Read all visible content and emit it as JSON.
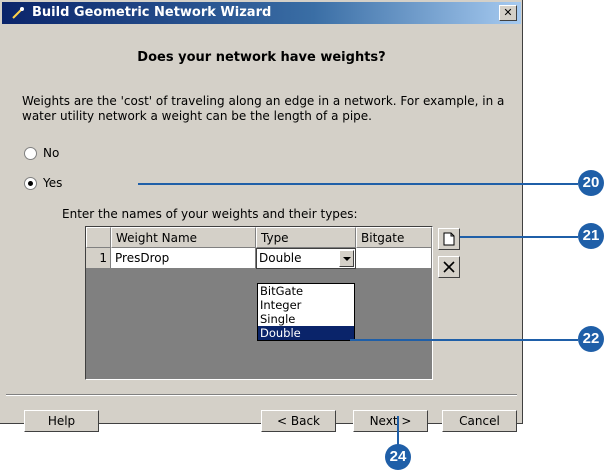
{
  "window": {
    "title": "Build Geometric Network Wizard",
    "close_label": "✕"
  },
  "heading": "Does your network have weights?",
  "description": "Weights are the 'cost' of traveling along an edge in a network. For example, in a water utility network a weight can be the length of a pipe.",
  "radios": [
    {
      "label": "No",
      "checked": false
    },
    {
      "label": "Yes",
      "checked": true
    }
  ],
  "table_label": "Enter the names of your weights and their types:",
  "table": {
    "columns": [
      "Weight Name",
      "Type",
      "Bitgate Size"
    ],
    "rows": [
      {
        "num": "1",
        "weight_name": "PresDrop",
        "type": "Double",
        "bitgate_size": ""
      }
    ]
  },
  "dropdown": {
    "options": [
      "BitGate",
      "Integer",
      "Single",
      "Double"
    ],
    "selected": "Double"
  },
  "side_buttons": {
    "new_icon": "new-document-icon",
    "delete_icon": "delete-x-icon"
  },
  "buttons": {
    "help": "Help",
    "back": "< Back",
    "next": "Next >",
    "cancel": "Cancel"
  },
  "callouts": [
    "20",
    "21",
    "22",
    "24"
  ],
  "colors": {
    "callout": "#1f5fa8",
    "titlebar": "#0a246a",
    "selection": "#0a246a",
    "dialog_bg": "#d4d0c8"
  }
}
